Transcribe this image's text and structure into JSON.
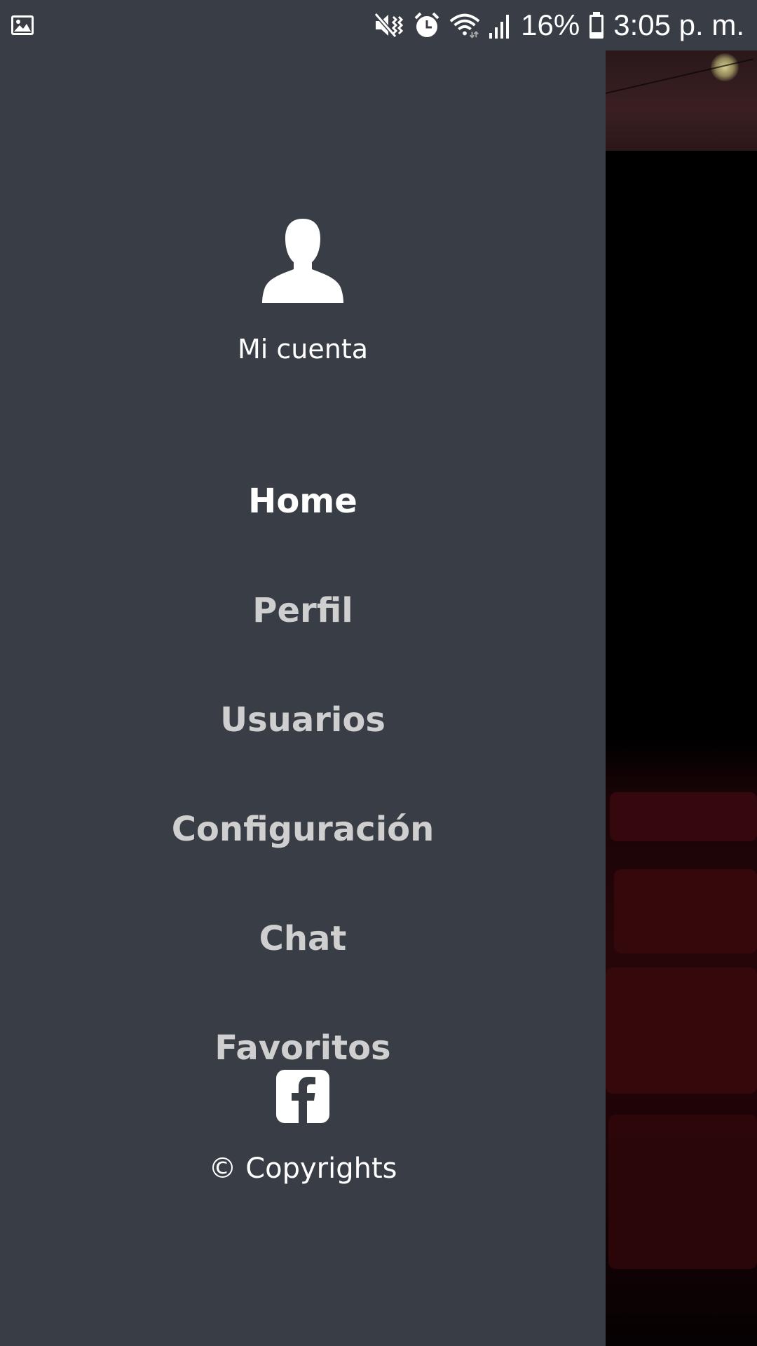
{
  "status_bar": {
    "battery_percent": "16%",
    "time": "3:05 p. m.",
    "icons": [
      "image-icon",
      "mute-icon",
      "alarm-icon",
      "wifi-icon",
      "signal-icon",
      "battery-icon"
    ]
  },
  "drawer": {
    "account_label": "Mi cuenta",
    "menu": [
      {
        "label": "Home",
        "active": true
      },
      {
        "label": "Perfil",
        "active": false
      },
      {
        "label": "Usuarios",
        "active": false
      },
      {
        "label": "Configuración",
        "active": false
      },
      {
        "label": "Chat",
        "active": false
      },
      {
        "label": "Favoritos",
        "active": false
      }
    ],
    "footer": {
      "social_icon": "facebook-icon",
      "copyright": "© Copyrights"
    }
  },
  "colors": {
    "drawer_bg": "#393e46",
    "active_text": "#ffffff",
    "inactive_text": "#cfcfcf"
  }
}
